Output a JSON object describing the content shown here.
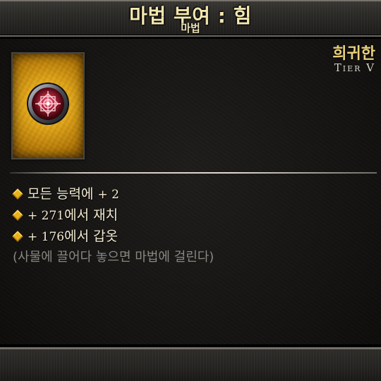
{
  "tooltip": {
    "title": "마법 부여 : 힘",
    "subtitle": "마법",
    "rarity": "희귀한",
    "tier": "Tier V",
    "item_icon": "golden-rune-card-icon",
    "properties": [
      {
        "prefix": "모든 능력에 ",
        "value": "+ 2",
        "suffix": ""
      },
      {
        "prefix": "",
        "value": "+ 271",
        "suffix": "에서 재치"
      },
      {
        "prefix": "",
        "value": "+ 176",
        "suffix": "에서 갑옷"
      }
    ],
    "hint": "(사물에 끌어다 놓으면 마법에 걸린다)"
  },
  "colors": {
    "title": "#f3e6b0",
    "rarity": "#e8cf7a",
    "bullet": "#e9b21c",
    "property_text": "#f2ead0",
    "hint_text": "#8a8781",
    "card_gold": "#e1a618",
    "orb_red": "#7a0f1c"
  }
}
